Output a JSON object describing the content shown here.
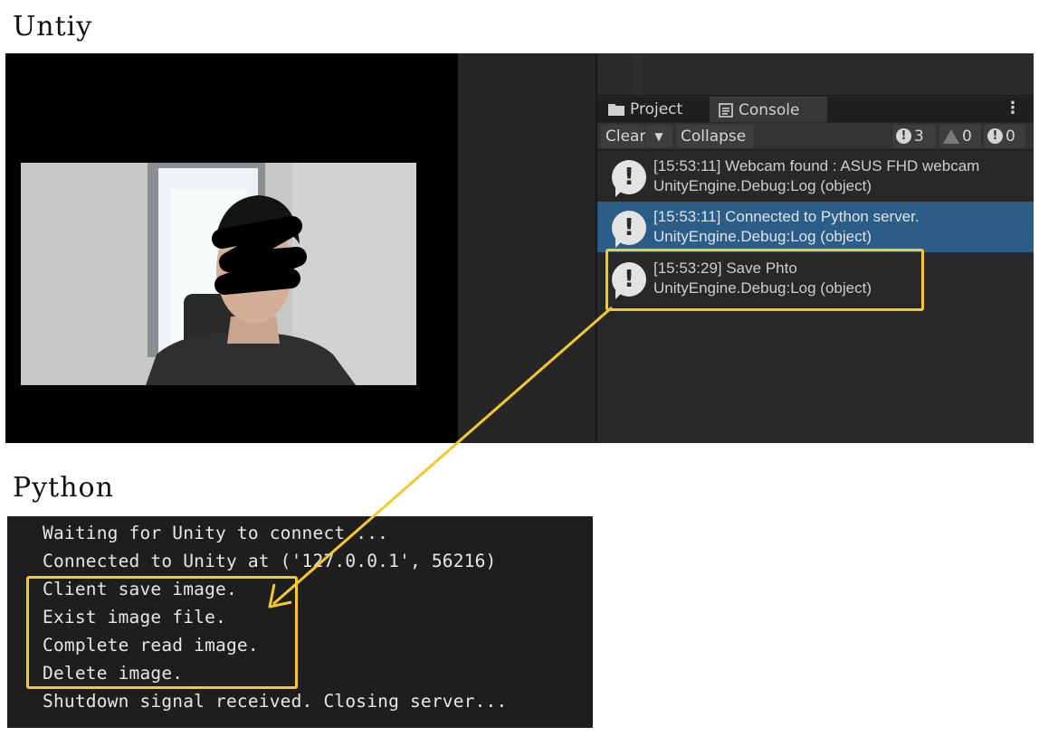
{
  "labels": {
    "unity": "Untiy",
    "python": "Python"
  },
  "unity": {
    "tabs": [
      {
        "label": "Project",
        "icon": "folder-icon"
      },
      {
        "label": "Console",
        "icon": "console-icon"
      }
    ],
    "toolbar": {
      "clear_label": "Clear",
      "collapse_label": "Collapse",
      "log_count": "3",
      "warning_count": "0",
      "error_count": "0"
    },
    "log_entries": [
      {
        "message": "[15:53:11] Webcam found : ASUS FHD webcam",
        "source": "UnityEngine.Debug:Log (object)",
        "selected": false
      },
      {
        "message": "[15:53:11] Connected to Python server.",
        "source": "UnityEngine.Debug:Log (object)",
        "selected": true
      },
      {
        "message": "[15:53:29] Save Phto",
        "source": "UnityEngine.Debug:Log (object)",
        "selected": false
      }
    ]
  },
  "python": {
    "lines": [
      "Waiting for Unity to connect ...",
      "Connected to Unity at ('127.0.0.1', 56216)",
      "Client save image.",
      "Exist image file.",
      "Complete read image.",
      "Delete image.",
      "Shutdown signal received. Closing server..."
    ]
  },
  "colors": {
    "highlight": "#f5c92a",
    "selected_row": "#2c5d87",
    "terminal_bg": "#1e1e1e"
  }
}
